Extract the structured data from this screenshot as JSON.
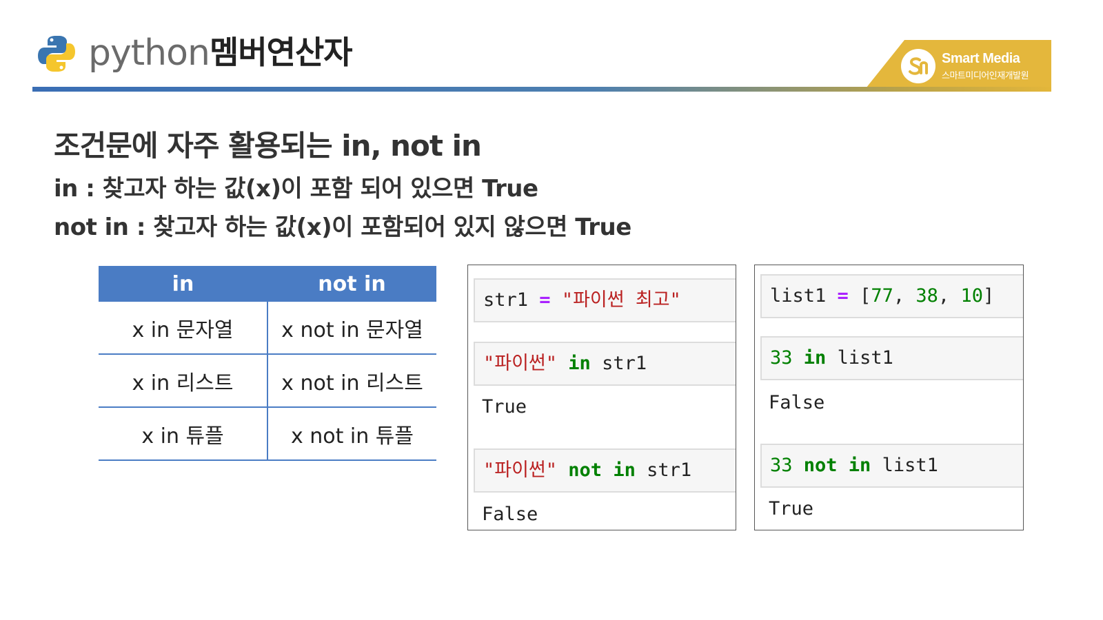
{
  "header": {
    "python_word": "python",
    "title": "멤버연산자",
    "brand": {
      "name": "Smart Media",
      "subtitle": "스마트미디어인재개발원"
    }
  },
  "content": {
    "heading": "조건문에 자주 활용되는 in, not in",
    "line1": "in : 찾고자 하는 값(x)이 포함 되어 있으면 True",
    "line2": "not in : 찾고자 하는 값(x)이 포함되어 있지 않으면 True"
  },
  "table": {
    "headers": [
      "in",
      "not in"
    ],
    "rows": [
      [
        "x in 문자열",
        "x not in 문자열"
      ],
      [
        "x in 리스트",
        "x not in 리스트"
      ],
      [
        "x in 튜플",
        "x not in 튜플"
      ]
    ]
  },
  "panel_a": {
    "cell1": {
      "var": "str1",
      "eq": "=",
      "str": "\"파이썬 최고\""
    },
    "cell2": {
      "str": "\"파이썬\"",
      "kw": "in",
      "var": "str1"
    },
    "out2": "True",
    "cell3": {
      "str": "\"파이썬\"",
      "kw": "not in",
      "var": "str1"
    },
    "out3": "False"
  },
  "panel_b": {
    "cell1": {
      "var": "list1",
      "eq": "=",
      "open": "[",
      "n1": "77",
      "sep1": ",",
      "n2": "38",
      "sep2": ",",
      "n3": "10",
      "close": "]"
    },
    "cell2": {
      "num": "33",
      "kw": "in",
      "var": "list1"
    },
    "out2": "False",
    "cell3": {
      "num": "33",
      "kw": "not in",
      "var": "list1"
    },
    "out3": "True"
  },
  "colors": {
    "table_header": "#4a7cc4",
    "brand": "#e4b73c",
    "keyword": "#008000",
    "operator": "#aa22ff",
    "string": "#ba2121"
  }
}
